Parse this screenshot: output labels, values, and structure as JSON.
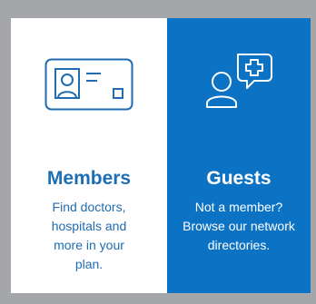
{
  "cards": {
    "members": {
      "title": "Members",
      "description": "Find doctors, hospitals and more in your plan.",
      "icon": "member-id-card-icon",
      "background": "#ffffff",
      "text_color": "#1d6eb4"
    },
    "guests": {
      "title": "Guests",
      "description": "Not a member? Browse our network directories.",
      "icon": "guest-chat-medical-icon",
      "background": "#0c72c4",
      "text_color": "#ffffff"
    }
  },
  "colors": {
    "page_background": "#a4a6a9",
    "accent_blue": "#0c72c4"
  }
}
